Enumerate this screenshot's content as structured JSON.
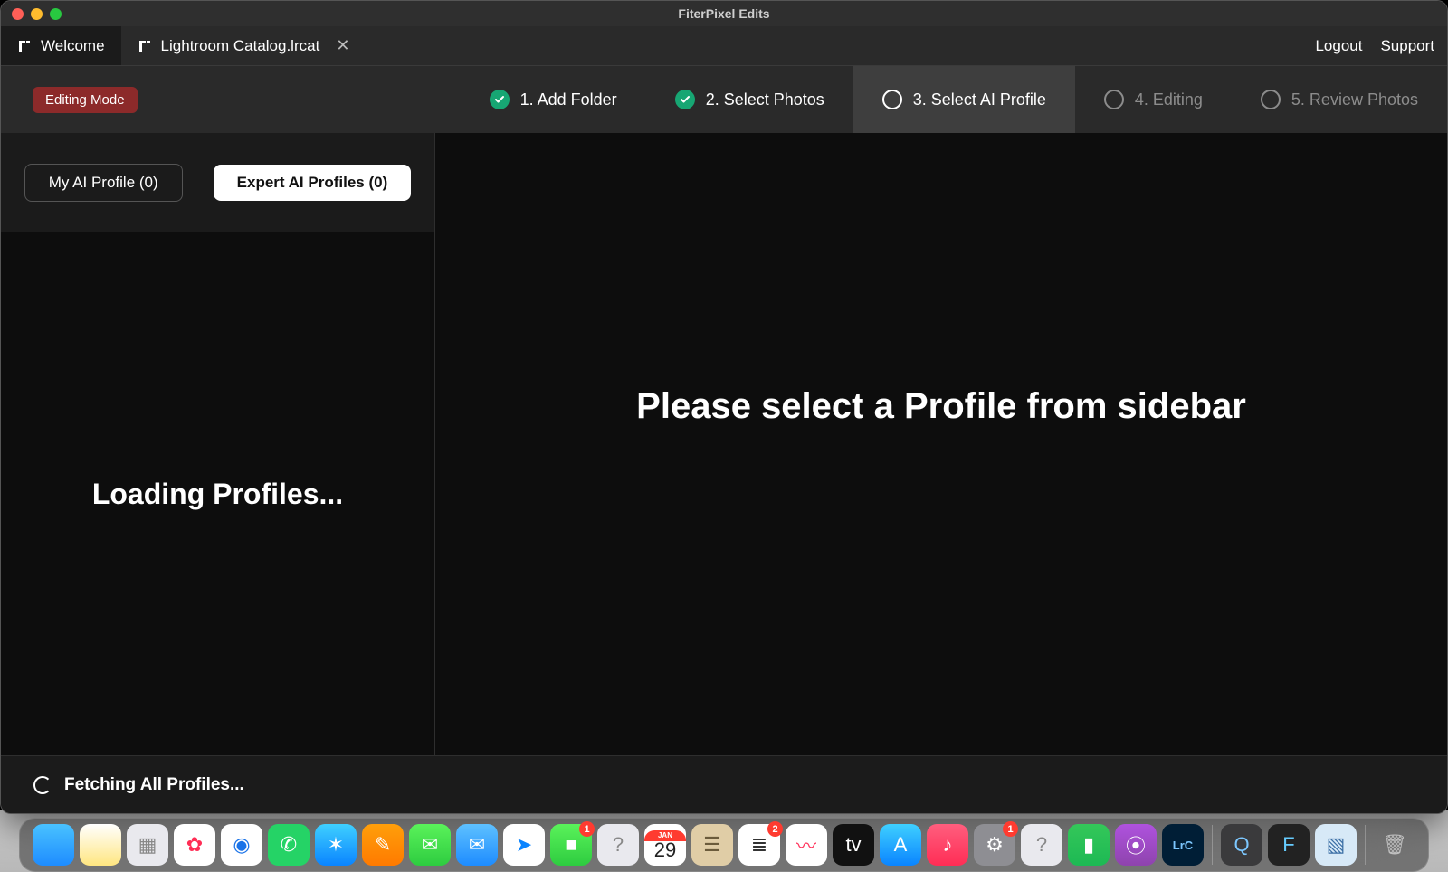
{
  "window": {
    "title": "FiterPixel Edits"
  },
  "tabs": [
    {
      "label": "Welcome",
      "active": true,
      "closable": false
    },
    {
      "label": "Lightroom Catalog.lrcat",
      "active": false,
      "closable": true
    }
  ],
  "header_links": {
    "logout": "Logout",
    "support": "Support"
  },
  "mode_badge": "Editing Mode",
  "steps": [
    {
      "label": "1. Add Folder",
      "state": "done"
    },
    {
      "label": "2. Select Photos",
      "state": "done"
    },
    {
      "label": "3. Select AI Profile",
      "state": "current"
    },
    {
      "label": "4. Editing",
      "state": "future"
    },
    {
      "label": "5. Review Photos",
      "state": "future"
    }
  ],
  "sidebar": {
    "tabs": {
      "mine": "My AI Profile (0)",
      "expert": "Expert AI Profiles (0)"
    },
    "loading": "Loading Profiles..."
  },
  "main": {
    "message": "Please select a Profile from sidebar"
  },
  "fetching": "Fetching All Profiles...",
  "calendar": {
    "month": "JAN",
    "day": "29"
  },
  "dock_badges": {
    "facetime": "1",
    "reminders": "2",
    "settings": "1"
  },
  "dock": [
    {
      "name": "finder-icon",
      "bg": "linear-gradient(#49c2ff,#1e8cff)",
      "glyph": ""
    },
    {
      "name": "notes-icon",
      "bg": "linear-gradient(#fff,#ffe680)",
      "glyph": ""
    },
    {
      "name": "launchpad-icon",
      "bg": "#e9e9ee",
      "glyph": "▦",
      "fg": "#888"
    },
    {
      "name": "photos-icon",
      "bg": "#fff",
      "glyph": "✿",
      "fg": "#ff2d55"
    },
    {
      "name": "chrome-icon",
      "bg": "#fff",
      "glyph": "◉",
      "fg": "#1a73e8"
    },
    {
      "name": "whatsapp-icon",
      "bg": "#25d366",
      "glyph": "✆"
    },
    {
      "name": "safari-icon",
      "bg": "linear-gradient(#3fd0ff,#0a84ff)",
      "glyph": "✶"
    },
    {
      "name": "pages-icon",
      "bg": "linear-gradient(#ff9f0a,#ff7a00)",
      "glyph": "✎"
    },
    {
      "name": "messages-icon",
      "bg": "linear-gradient(#5af25a,#2ecc40)",
      "glyph": "✉"
    },
    {
      "name": "mail-icon",
      "bg": "linear-gradient(#5ec1ff,#1e8cff)",
      "glyph": "✉"
    },
    {
      "name": "maps-icon",
      "bg": "#fff",
      "glyph": "➤",
      "fg": "#0a84ff"
    },
    {
      "name": "facetime-icon",
      "bg": "linear-gradient(#5af25a,#2ecc40)",
      "glyph": "■",
      "badge_key": "facetime"
    },
    {
      "name": "help-icon",
      "bg": "#e9e9ee",
      "glyph": "?",
      "fg": "#888"
    },
    {
      "name": "calendar-icon",
      "calendar": true
    },
    {
      "name": "contacts-icon",
      "bg": "#e0cda6",
      "glyph": "☰",
      "fg": "#6b5b3b"
    },
    {
      "name": "reminders-icon",
      "bg": "#fff",
      "glyph": "≣",
      "fg": "#333",
      "badge_key": "reminders"
    },
    {
      "name": "freeform-icon",
      "bg": "#fff",
      "glyph": "〰",
      "fg": "#ff375f"
    },
    {
      "name": "tv-icon",
      "bg": "#111",
      "glyph": "tv",
      "fg": "#fff"
    },
    {
      "name": "appstore-icon",
      "bg": "linear-gradient(#3fd0ff,#0a84ff)",
      "glyph": "A"
    },
    {
      "name": "music-icon",
      "bg": "linear-gradient(#ff5e7e,#ff2d55)",
      "glyph": "♪"
    },
    {
      "name": "settings-icon",
      "bg": "#8e8e93",
      "glyph": "⚙",
      "badge_key": "settings"
    },
    {
      "name": "help2-icon",
      "bg": "#e9e9ee",
      "glyph": "?",
      "fg": "#888"
    },
    {
      "name": "numbers-icon",
      "bg": "linear-gradient(#34c759,#1db954)",
      "glyph": "▮"
    },
    {
      "name": "podcasts-icon",
      "bg": "linear-gradient(#af52de,#8e44ad)",
      "glyph": "⦿"
    },
    {
      "name": "lightroom-icon",
      "bg": "#001e36",
      "glyph": "LrC",
      "fg": "#7cc7ff"
    },
    {
      "sep": true
    },
    {
      "name": "quicktime-icon",
      "bg": "#3a3a3c",
      "glyph": "Q",
      "fg": "#7cc7ff"
    },
    {
      "name": "fiterpixel-icon",
      "bg": "#222",
      "glyph": "F",
      "fg": "#6cf"
    },
    {
      "name": "preview-icon",
      "bg": "#d7e9f7",
      "glyph": "▧",
      "fg": "#3a6ea5"
    },
    {
      "sep": true
    },
    {
      "name": "trash-icon",
      "bg": "transparent",
      "glyph": "🗑",
      "fg": "#bfbfbf"
    }
  ]
}
